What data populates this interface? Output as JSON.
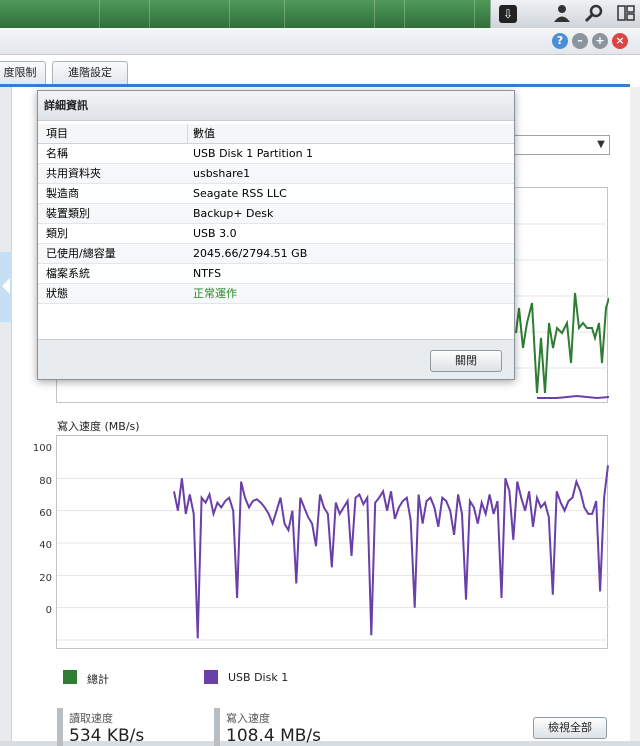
{
  "tabs": [
    {
      "label": "度限制"
    },
    {
      "label": "進階設定"
    }
  ],
  "dialog": {
    "title": "詳細資訊",
    "headers": {
      "item": "項目",
      "value": "數值"
    },
    "rows": [
      {
        "item": "名稱",
        "value": "USB Disk 1 Partition 1"
      },
      {
        "item": "共用資料夾",
        "value": "usbshare1"
      },
      {
        "item": "製造商",
        "value": "Seagate RSS LLC"
      },
      {
        "item": "裝置類別",
        "value": "Backup+ Desk"
      },
      {
        "item": "類別",
        "value": "USB 3.0"
      },
      {
        "item": "已使用/總容量",
        "value": "2045.66/2794.51 GB"
      },
      {
        "item": "檔案系統",
        "value": "NTFS"
      },
      {
        "item": "狀態",
        "value": "正常運作"
      }
    ],
    "status_color": "#2a8a2a",
    "close_label": "關閉"
  },
  "chart_data": [
    {
      "type": "line",
      "ylabel": "寫入速度 (MB/s)",
      "yticks": [
        "100",
        "80",
        "60",
        "40",
        "20",
        "0"
      ],
      "ylim": [
        0,
        120
      ],
      "series": [
        {
          "name": "USB Disk 1",
          "color": "#6a3fa8",
          "values": [
            92,
            80,
            100,
            78,
            90,
            78,
            1,
            88,
            85,
            90,
            78,
            85,
            82,
            86,
            88,
            80,
            26,
            98,
            88,
            82,
            86,
            87,
            85,
            82,
            78,
            72,
            80,
            88,
            72,
            68,
            80,
            35,
            88,
            82,
            76,
            72,
            58,
            90,
            82,
            78,
            45,
            85,
            78,
            82,
            86,
            52,
            88,
            90,
            84,
            88,
            3,
            85,
            88,
            92,
            80,
            92,
            75,
            82,
            86,
            88,
            74,
            20,
            90,
            72,
            86,
            88,
            82,
            70,
            88,
            86,
            80,
            65,
            90,
            78,
            25,
            86,
            82,
            72,
            85,
            78,
            90,
            78,
            86,
            26,
            100,
            92,
            62,
            98,
            88,
            80,
            92,
            70,
            88,
            82,
            85,
            76,
            28,
            92,
            85,
            80,
            86,
            88,
            98,
            92,
            82,
            78,
            78,
            86,
            30,
            88,
            108
          ]
        }
      ]
    }
  ],
  "legend": [
    {
      "label": "總計",
      "color": "#2e7d32"
    },
    {
      "label": "USB Disk 1",
      "color": "#6a3fa8"
    }
  ],
  "stats": {
    "read_label": "讀取速度",
    "read_value": "534 KB/s",
    "write_label": "寫入速度",
    "write_value": "108.4 MB/s"
  },
  "view_all_label": "檢視全部"
}
